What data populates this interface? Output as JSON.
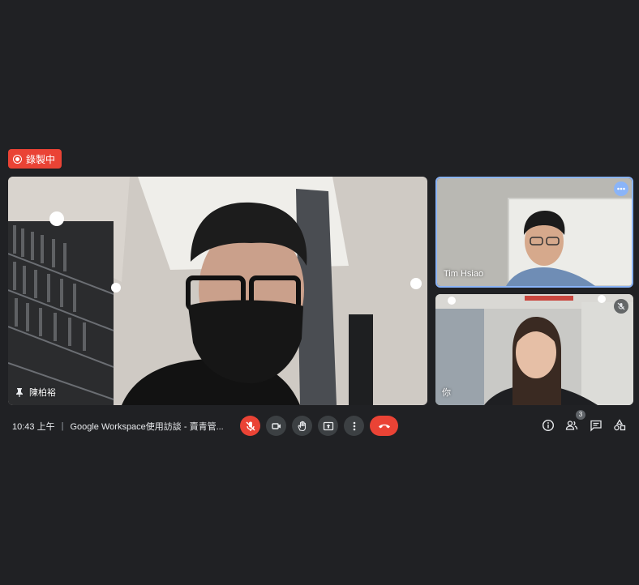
{
  "recording": {
    "label": "錄製中",
    "icon": "record-icon"
  },
  "tiles": {
    "main": {
      "name": "陳柏裕",
      "icon": "pin-icon"
    },
    "participant_1": {
      "name": "Tim Hsiao",
      "icon": "more-options-icon"
    },
    "participant_2": {
      "name": "你",
      "icon": "mic-off-icon"
    }
  },
  "bottom_bar": {
    "time": "10:43 上午",
    "separator": "|",
    "meeting_title": "Google Workspace使用訪談 - 賣青管...",
    "controls": [
      "mic-off-icon",
      "camera-icon",
      "raise-hand-icon",
      "present-icon",
      "more-vert-icon",
      "end-call-icon"
    ],
    "side_buttons": [
      "info-icon",
      "people-icon",
      "chat-icon",
      "activities-icon"
    ],
    "people_count": "3"
  },
  "colors": {
    "background": "#202124",
    "accent_red": "#ea4335",
    "control_gray": "#3c4043",
    "highlight_blue": "#8ab4f8"
  }
}
